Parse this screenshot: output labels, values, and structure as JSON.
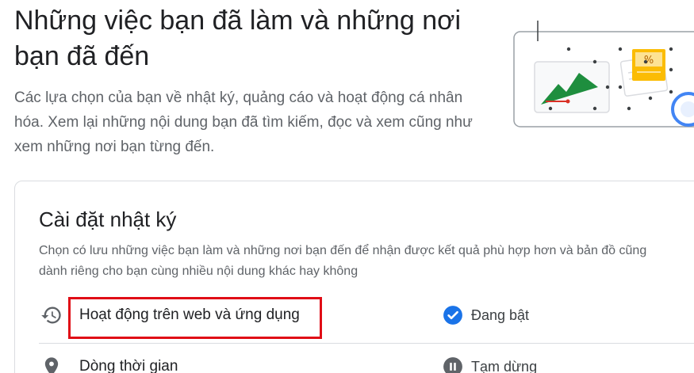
{
  "header": {
    "title": "Những việc bạn đã làm và những nơi bạn đã đến",
    "description": "Các lựa chọn của bạn về nhật ký, quảng cáo và hoạt động cá nhân hóa. Xem lại những nội dung bạn đã tìm kiếm, đọc và xem cũng như xem những nơi bạn từng đến."
  },
  "settings_card": {
    "title": "Cài đặt nhật ký",
    "description": "Chọn có lưu những việc bạn làm và những nơi bạn đến để nhận được kết quả phù hợp hơn và bản đồ cũng như nội dung dành riêng cho bạn cùng nhiều nội dung khác hay không",
    "description_lines": [
      "Chọn có lưu những việc bạn làm và những nơi bạn đến để nhận được kết quả phù hợp hơn và bản đồ cũng",
      "dành riêng cho bạn cùng nhiều nội dung khác hay không"
    ],
    "items": [
      {
        "label": "Hoạt động trên web và ứng dụng",
        "icon": "history-icon",
        "status": "Đang bật",
        "status_icon": "check-circle-icon",
        "status_color": "#1a73e8"
      },
      {
        "label": "Dòng thời gian",
        "icon": "location-pin-icon",
        "status": "Tạm dừng",
        "status_icon": "pause-circle-icon",
        "status_color": "#5f6368"
      }
    ]
  },
  "highlight": {
    "color": "#e00d16",
    "target": "Hoạt động trên web và ứng dụng"
  },
  "colors": {
    "accent": "#1a73e8",
    "text_primary": "#202124",
    "text_secondary": "#5f6368",
    "divider": "#dadce0"
  }
}
